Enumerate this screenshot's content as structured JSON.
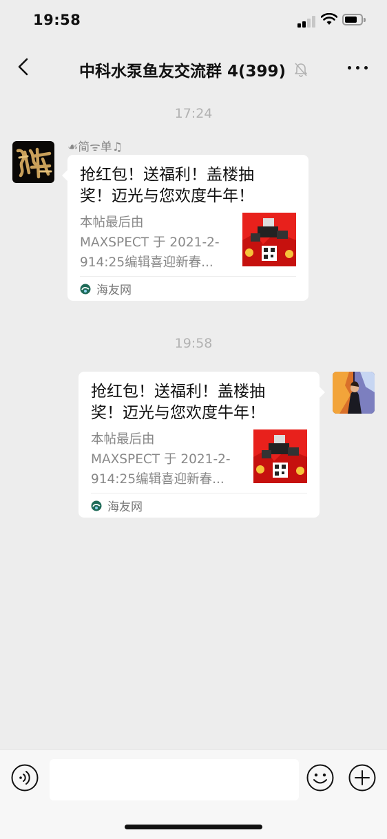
{
  "status": {
    "time": "19:58",
    "icons": [
      "signal-icon",
      "wifi-icon",
      "battery-icon"
    ]
  },
  "nav": {
    "back_icon": "chevron-left-icon",
    "title": "中科水泵鱼友交流群 4(399)",
    "mute_icon": "bell-muted-icon",
    "more_icon": "more-dots-icon"
  },
  "chat": {
    "messages": [
      {
        "timestamp": "17:24",
        "side": "left",
        "sender": "☙简ᯤ单♫",
        "card": {
          "title": "抢红包！送福利！盖楼抽奖！迈光与您欢度牛年！",
          "title_line1": "抢红包！送福利！盖楼抽",
          "title_line2": "奖！迈光与您欢度牛年！",
          "desc_line1": "本帖最后由",
          "desc_line2": "MAXSPECT 于 2021-2-",
          "desc_line3": "914:25编辑喜迎新春...",
          "source": "海友网"
        }
      },
      {
        "timestamp": "19:58",
        "side": "right",
        "card": {
          "title_line1": "抢红包！送福利！盖楼抽",
          "title_line2": "奖！迈光与您欢度牛年！",
          "desc_line1": "本帖最后由",
          "desc_line2": "MAXSPECT 于 2021-2-",
          "desc_line3": "914:25编辑喜迎新春...",
          "source": "海友网"
        }
      }
    ]
  },
  "input": {
    "voice_icon": "voice-icon",
    "value": "",
    "emoji_icon": "emoji-icon",
    "plus_icon": "plus-icon"
  },
  "colors": {
    "background": "#ededed",
    "bubble": "#ffffff",
    "muted_text": "#888888",
    "timestamp": "#b2b2b2",
    "thumb_red": "#e8211c"
  }
}
